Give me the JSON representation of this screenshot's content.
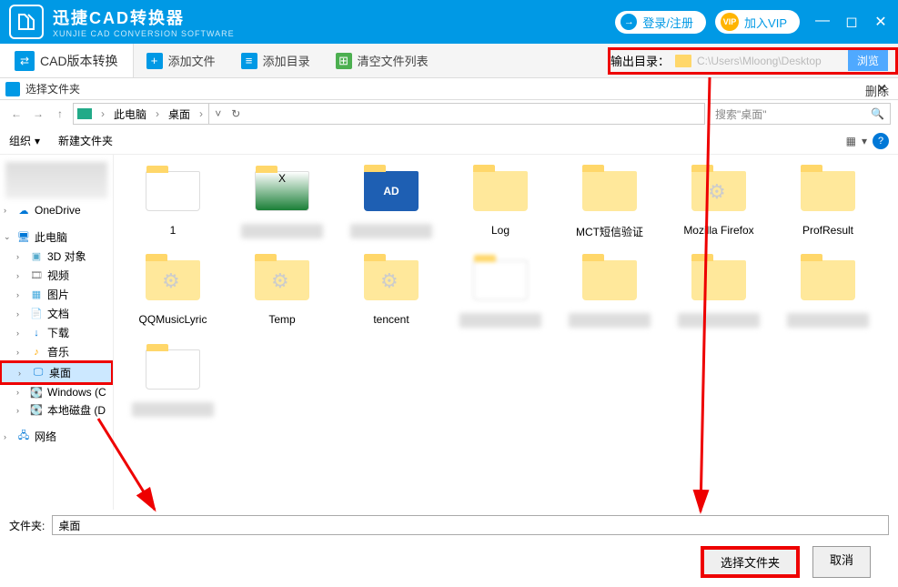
{
  "titlebar": {
    "app_title": "迅捷CAD转换器",
    "app_sub": "XUNJIE CAD CONVERSION SOFTWARE",
    "login": "登录/注册",
    "vip": "加入VIP"
  },
  "toolbar": {
    "side": "CAD版本转换",
    "add_file": "添加文件",
    "add_dir": "添加目录",
    "clear": "清空文件列表",
    "out_label": "输出目录：",
    "out_path": "C:\\Users\\Mloong\\Desktop",
    "browse": "浏览",
    "delete": "删除"
  },
  "dialog": {
    "title": "选择文件夹",
    "crumb1": "此电脑",
    "crumb2": "桌面",
    "search_ph": "搜索\"桌面\"",
    "organize": "组织",
    "new_folder": "新建文件夹",
    "folder_label": "文件夹:",
    "folder_value": "桌面",
    "select_btn": "选择文件夹",
    "cancel_btn": "取消"
  },
  "tree": {
    "onedrive": "OneDrive",
    "thispc": "此电脑",
    "obj3d": "3D 对象",
    "video": "视频",
    "pics": "图片",
    "docs": "文档",
    "downloads": "下载",
    "music": "音乐",
    "desktop": "桌面",
    "windows": "Windows (C",
    "localdisk": "本地磁盘 (D",
    "network": "网络"
  },
  "grid": {
    "r1": [
      "1",
      "",
      "",
      "Log",
      "MCT短信验证",
      "Mozilla Firefox",
      "ProfResult"
    ],
    "r2": [
      "QQMusicLyric",
      "Temp",
      "tencent",
      "",
      "",
      "",
      ""
    ]
  }
}
